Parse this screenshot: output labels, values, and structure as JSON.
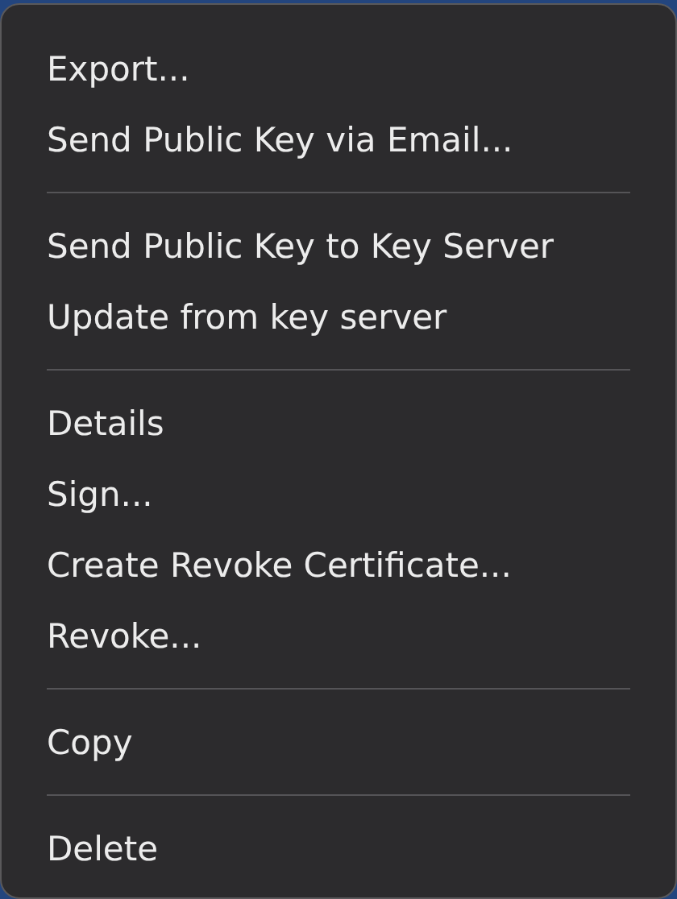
{
  "menu": {
    "groups": [
      {
        "items": [
          {
            "label": "Export..."
          },
          {
            "label": "Send Public Key via Email..."
          }
        ]
      },
      {
        "items": [
          {
            "label": "Send Public Key to Key Server"
          },
          {
            "label": "Update from key server"
          }
        ]
      },
      {
        "items": [
          {
            "label": "Details"
          },
          {
            "label": "Sign..."
          },
          {
            "label": "Create Revoke Certificate..."
          },
          {
            "label": "Revoke..."
          }
        ]
      },
      {
        "items": [
          {
            "label": "Copy"
          }
        ]
      },
      {
        "items": [
          {
            "label": "Delete"
          }
        ]
      }
    ]
  }
}
